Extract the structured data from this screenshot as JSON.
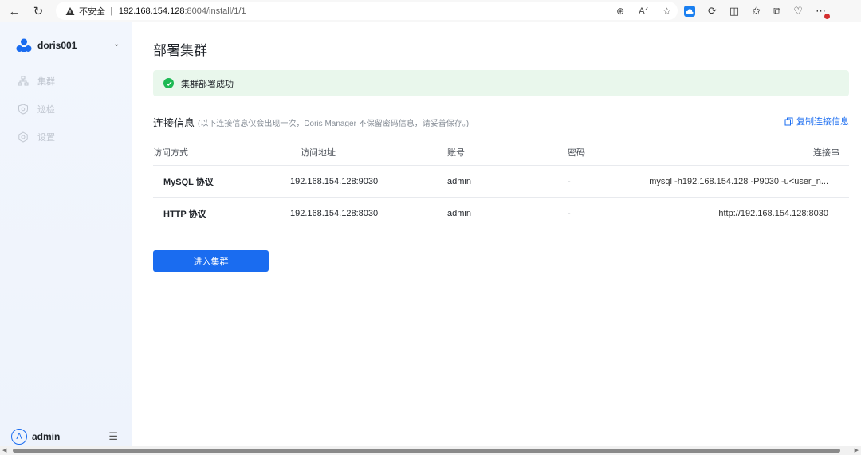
{
  "browser": {
    "insecure_label": "不安全",
    "separator": "|",
    "url_host": "192.168.154.128",
    "url_rest": ":8004/install/1/1"
  },
  "sidebar": {
    "cluster_name": "doris001",
    "items": [
      {
        "label": "集群",
        "icon": "cluster-icon"
      },
      {
        "label": "巡检",
        "icon": "shield-icon"
      },
      {
        "label": "设置",
        "icon": "gear-icon"
      }
    ],
    "user": {
      "avatar_letter": "A",
      "name": "admin"
    }
  },
  "main": {
    "title": "部署集群",
    "alert_text": "集群部署成功",
    "section_title": "连接信息",
    "section_note": "(以下连接信息仅会出现一次，Doris Manager 不保留密码信息，请妥善保存。)",
    "copy_label": "复制连接信息",
    "table": {
      "headers": [
        "访问方式",
        "访问地址",
        "账号",
        "密码",
        "连接串"
      ],
      "rows": [
        {
          "method": "MySQL 协议",
          "address": "192.168.154.128:9030",
          "account": "admin",
          "password": "-",
          "conn": "mysql -h192.168.154.128 -P9030 -u<user_n..."
        },
        {
          "method": "HTTP 协议",
          "address": "192.168.154.128:8030",
          "account": "admin",
          "password": "-",
          "conn": "http://192.168.154.128:8030"
        }
      ]
    },
    "enter_button": "进入集群"
  },
  "colors": {
    "primary": "#1a6cf0",
    "success": "#1db954",
    "alert_bg": "#e9f7ec",
    "sidebar_bg": "#f2f6fd"
  }
}
